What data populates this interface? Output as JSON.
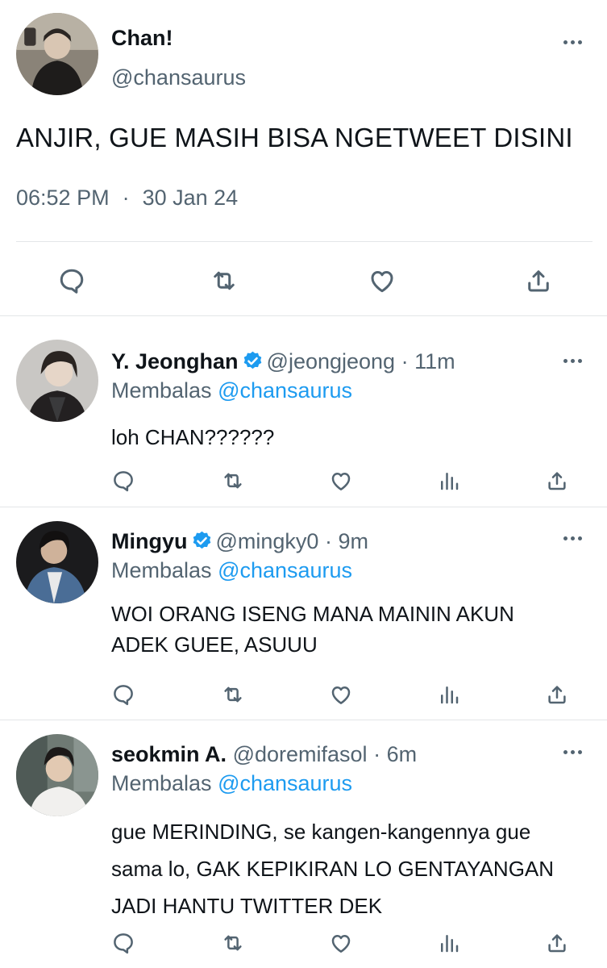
{
  "main_tweet": {
    "name": "Chan!",
    "handle": "@chansaurus",
    "text": "ANJIR, GUE MASIH BISA NGETWEET DISINI",
    "time": "06:52 PM",
    "separator": "·",
    "date": "30 Jan 24"
  },
  "replies": [
    {
      "name": "Y. Jeonghan",
      "verified": true,
      "handle": "@jeongjeong",
      "separator": "·",
      "age": "11m",
      "replying_label": "Membalas",
      "replying_to": "@chansaurus",
      "text": "loh CHAN??????"
    },
    {
      "name": "Mingyu",
      "verified": true,
      "handle": "@mingky0",
      "separator": "·",
      "age": "9m",
      "replying_label": "Membalas",
      "replying_to": "@chansaurus",
      "text": "WOI ORANG ISENG MANA MAININ AKUN ADEK GUEE, ASUUU"
    },
    {
      "name": "seokmin A.",
      "verified": false,
      "handle": "@doremifasol",
      "separator": "·",
      "age": "6m",
      "replying_label": "Membalas",
      "replying_to": "@chansaurus",
      "text": "gue MERINDING, se kangen-kangennya gue sama lo, GAK KEPIKIRAN LO GENTAYANGAN JADI HANTU TWITTER DEK"
    }
  ],
  "icons": {
    "reply": "speech-bubble-outline",
    "retweet": "retweet-arrows",
    "like": "heart-outline",
    "views": "bar-chart",
    "share": "upload-arrow",
    "more": "three-dots",
    "verified": "blue-check-badge"
  },
  "colors": {
    "text": "#0f1419",
    "secondary": "#536471",
    "accent": "#1d9bf0",
    "divider": "#e3e6e8"
  }
}
